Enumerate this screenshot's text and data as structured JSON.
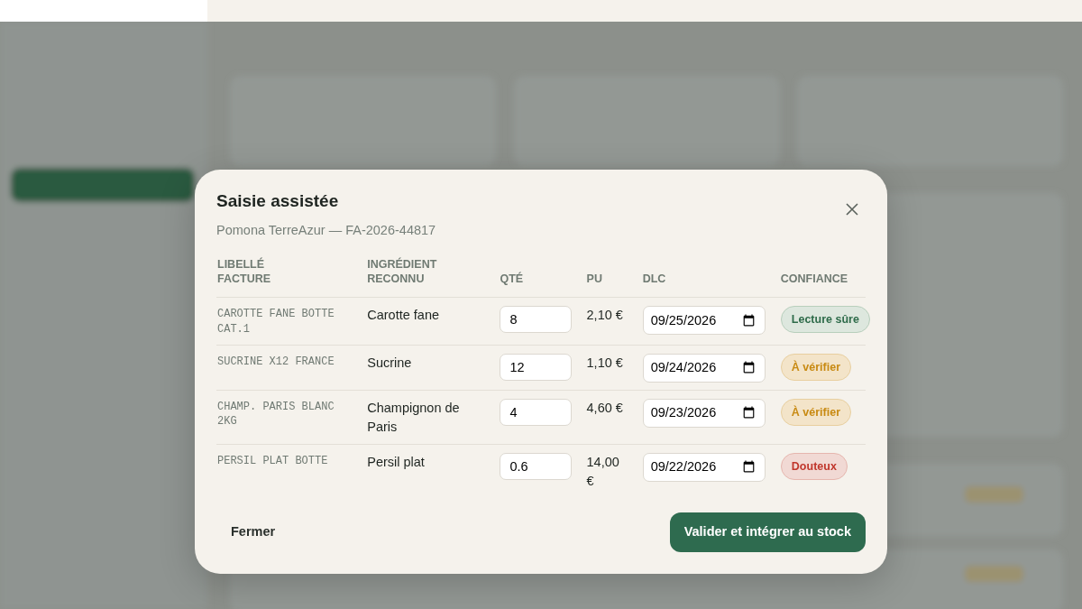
{
  "dialog": {
    "title": "Saisie assistée",
    "subtitle": "Pomona TerreAzur — FA-2026-44817",
    "columns": [
      "LIBELLÉ FACTURE",
      "INGRÉDIENT RECONNU",
      "QTÉ",
      "PU",
      "DLC",
      "CONFIANCE"
    ],
    "rows": [
      {
        "invoice_label": "CAROTTE FANE BOTTE CAT.1",
        "ingredient": "Carotte fane",
        "quantity": "8",
        "unit_price": "2,10 €",
        "dlc": "09/25/2026",
        "confidence": {
          "kind": "sure",
          "text": "Lecture sûre"
        }
      },
      {
        "invoice_label": "SUCRINE X12 FRANCE",
        "ingredient": "Sucrine",
        "quantity": "12",
        "unit_price": "1,10 €",
        "dlc": "09/24/2026",
        "confidence": {
          "kind": "check",
          "text": "À vérifier"
        }
      },
      {
        "invoice_label": "CHAMP. PARIS BLANC 2KG",
        "ingredient": "Champignon de Paris",
        "quantity": "4",
        "unit_price": "4,60 €",
        "dlc": "09/23/2026",
        "confidence": {
          "kind": "check",
          "text": "À vérifier"
        }
      },
      {
        "invoice_label": "PERSIL PLAT BOTTE",
        "ingredient": "Persil plat",
        "quantity": "0.6",
        "unit_price": "14,00 €",
        "dlc": "09/22/2026",
        "confidence": {
          "kind": "doubt",
          "text": "Douteux"
        }
      }
    ],
    "buttons": {
      "close": "Fermer",
      "confirm": "Valider et intégrer au stock"
    }
  }
}
